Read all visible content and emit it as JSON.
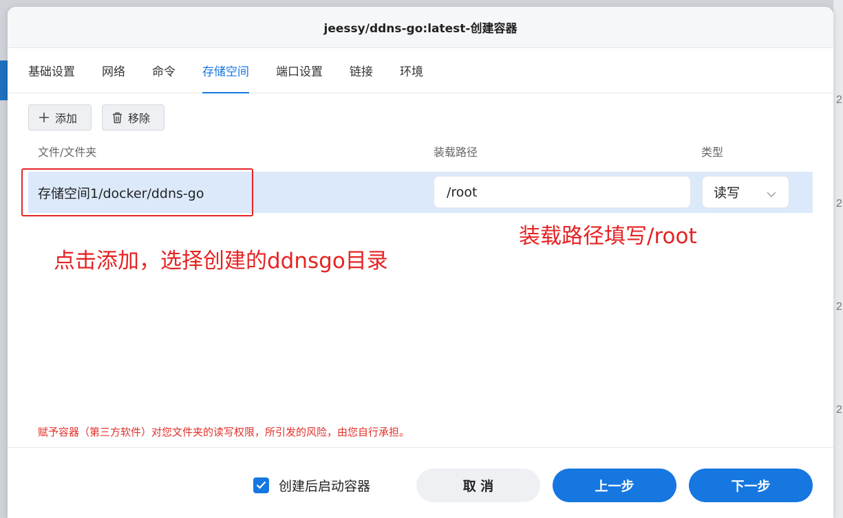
{
  "dialog": {
    "title": "jeessy/ddns-go:latest-创建容器"
  },
  "tabs": [
    {
      "label": "基础设置"
    },
    {
      "label": "网络"
    },
    {
      "label": "命令"
    },
    {
      "label": "存储空间",
      "active": true
    },
    {
      "label": "端口设置"
    },
    {
      "label": "链接"
    },
    {
      "label": "环境"
    }
  ],
  "toolbar": {
    "add_label": "添加",
    "remove_label": "移除",
    "add_icon": "plus-icon",
    "remove_icon": "trash-icon"
  },
  "table": {
    "headers": {
      "file": "文件/文件夹",
      "mount": "装载路径",
      "type": "类型"
    },
    "rows": [
      {
        "path": "存储空间1/docker/ddns-go",
        "mount": "/root",
        "type": "读写"
      }
    ]
  },
  "annotations": {
    "add_hint": "点击添加，选择创建的ddnsgo目录",
    "mount_hint": "装载路径填写/root",
    "color": "#e52323"
  },
  "warning": "赋予容器（第三方软件）对您文件夹的读写权限，所引发的风险，由您自行承担。",
  "footer": {
    "checkbox_label": "创建后启动容器",
    "checkbox_checked": true,
    "cancel": "取 消",
    "prev": "上一步",
    "next": "下一步"
  },
  "background": {
    "right_glyph": "2"
  },
  "colors": {
    "accent": "#1677e0",
    "row_selected": "#dbe9fb",
    "warning": "#e0302a"
  }
}
